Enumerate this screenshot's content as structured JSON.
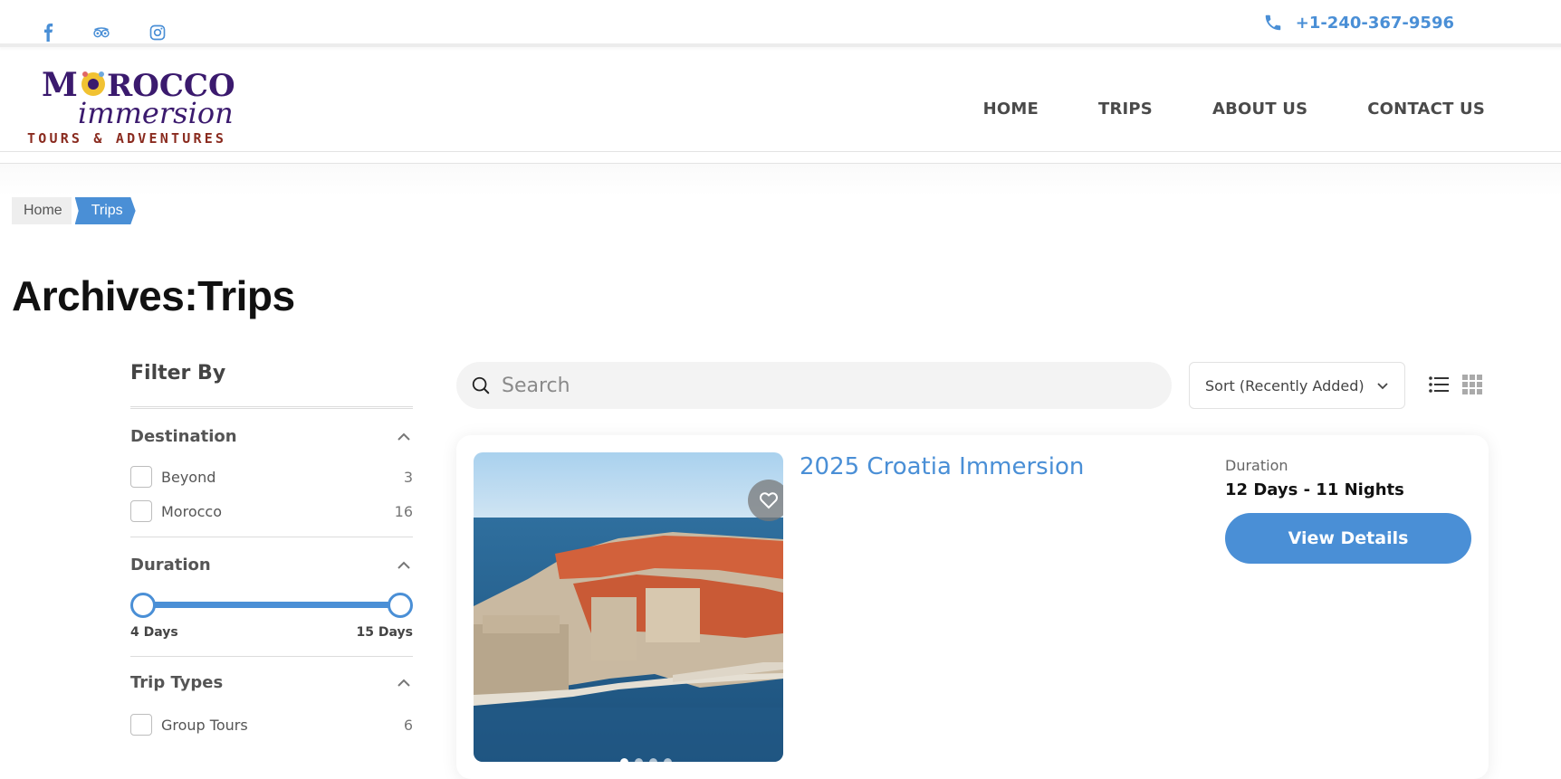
{
  "topbar": {
    "social": [
      {
        "name": "facebook-icon"
      },
      {
        "name": "tripadvisor-icon"
      },
      {
        "name": "instagram-icon"
      }
    ],
    "phone": "+1-240-367-9596"
  },
  "logo": {
    "line1": "MOROCCO",
    "line2": "immersion",
    "line3": "TOURS & ADVENTURES"
  },
  "nav": {
    "home": "HOME",
    "trips": "TRIPS",
    "about": "ABOUT US",
    "contact": "CONTACT US"
  },
  "breadcrumb": {
    "home": "Home",
    "current": "Trips"
  },
  "page_title": "Archives:Trips",
  "filter": {
    "title": "Filter By",
    "destination": {
      "title": "Destination",
      "options": [
        {
          "label": "Beyond",
          "count": "3"
        },
        {
          "label": "Morocco",
          "count": "16"
        }
      ]
    },
    "duration": {
      "title": "Duration",
      "min_label": "4 Days",
      "max_label": "15 Days",
      "range_start_fraction": 0.0,
      "range_end_fraction": 1.0
    },
    "trip_types": {
      "title": "Trip Types",
      "options": [
        {
          "label": "Group Tours",
          "count": "6"
        }
      ]
    }
  },
  "search": {
    "placeholder": "Search"
  },
  "sort": {
    "selected": "Sort (Recently Added)"
  },
  "trip": {
    "title": "2025 Croatia Immersion",
    "duration_label": "Duration",
    "duration_value": "12 Days - 11 Nights",
    "button": "View Details",
    "image_alt": "Coastal walled city photo",
    "slide_count": 4,
    "active_slide": 1
  },
  "colors": {
    "accent": "#4a8fd6",
    "text_dark": "#111111",
    "logo_purple": "#3b1a6e",
    "logo_red": "#8a2b1f"
  }
}
